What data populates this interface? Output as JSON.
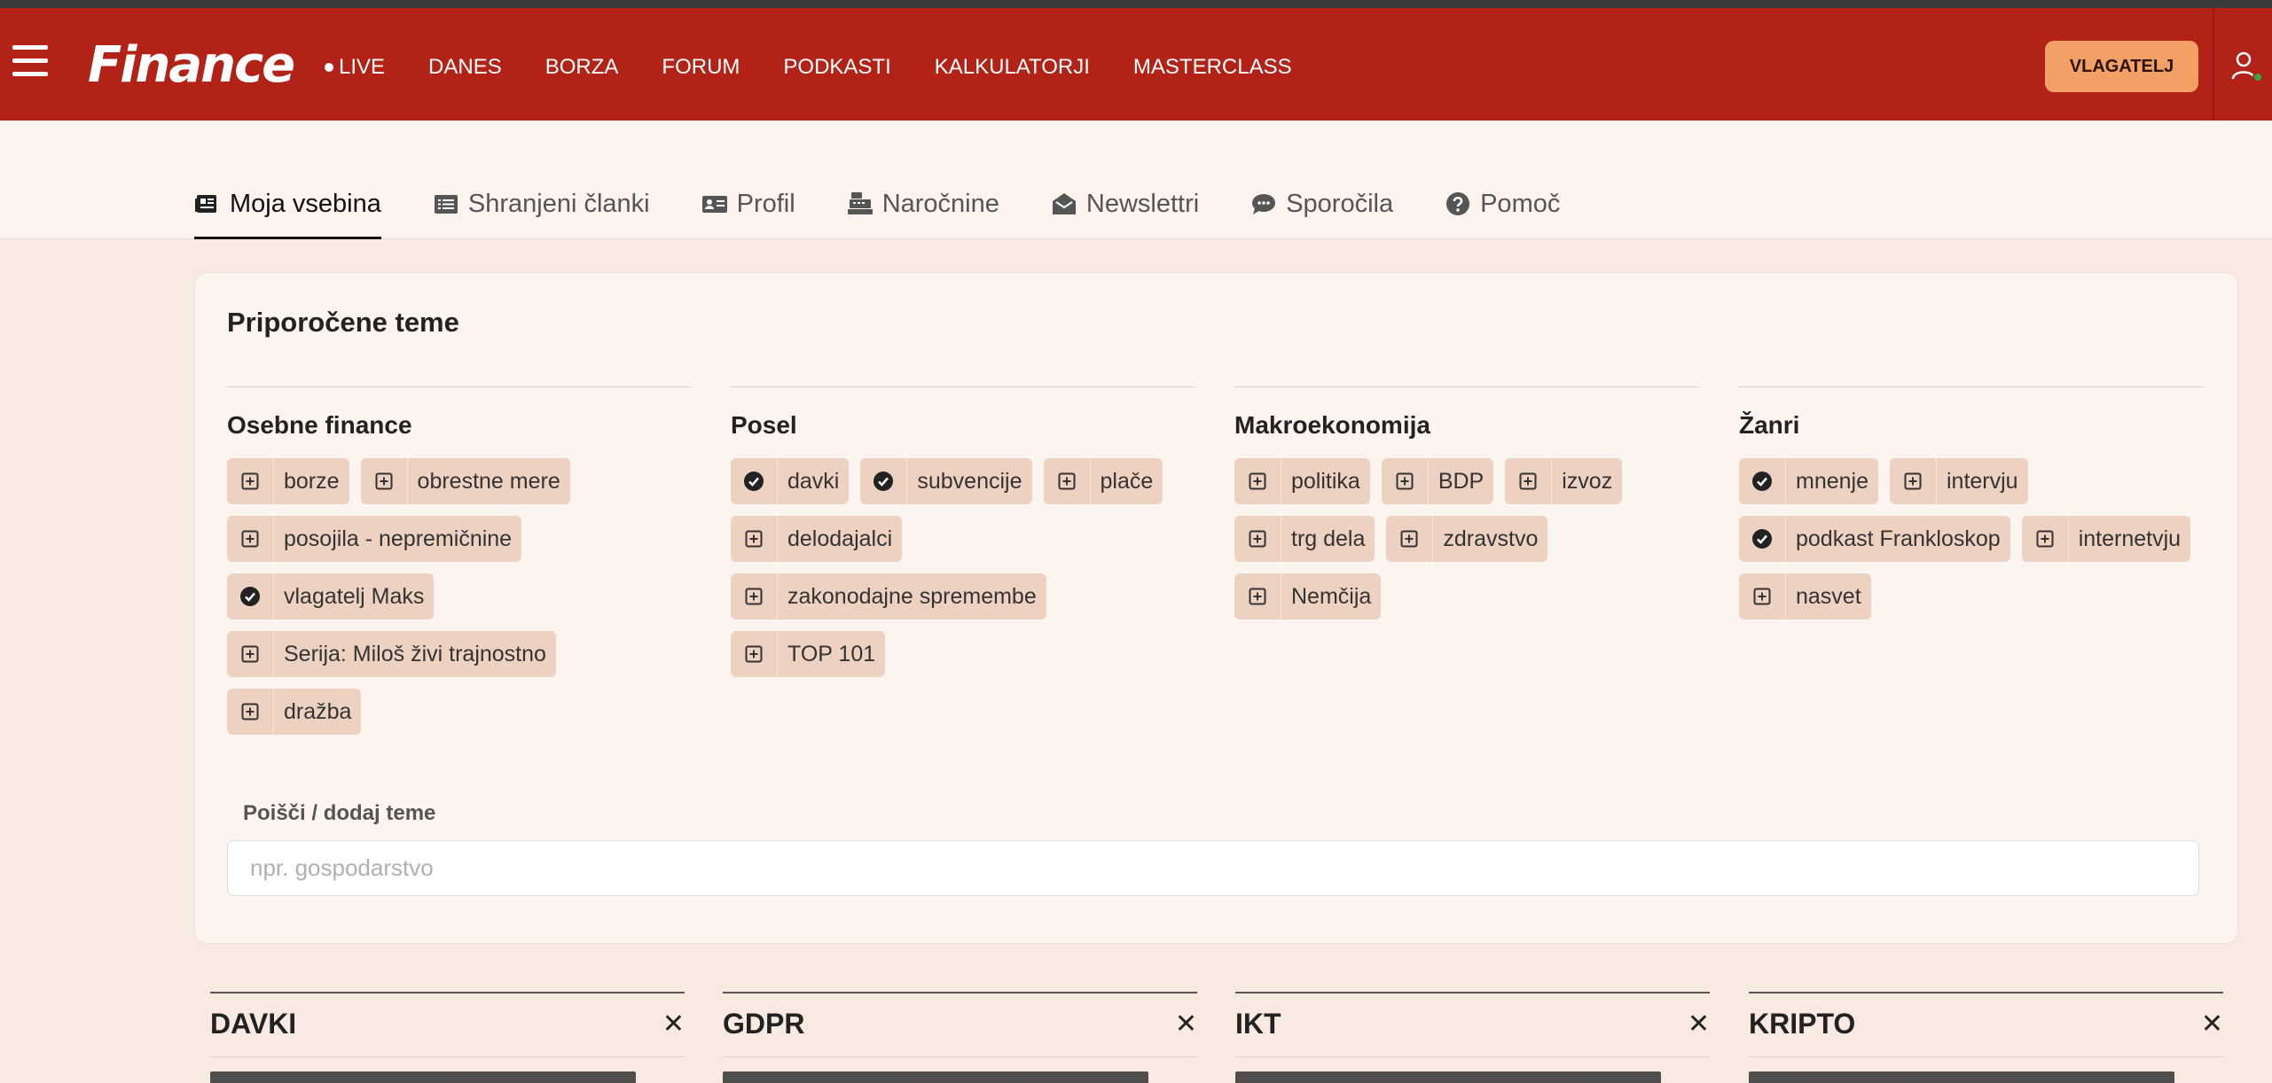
{
  "header": {
    "logo": "Finance",
    "nav": [
      {
        "label": "LIVE",
        "dot": true
      },
      {
        "label": "DANES"
      },
      {
        "label": "BORZA"
      },
      {
        "label": "FORUM"
      },
      {
        "label": "PODKASTI"
      },
      {
        "label": "KALKULATORJI"
      },
      {
        "label": "MASTERCLASS"
      }
    ],
    "cta_label": "VLAGATELJ",
    "colors": {
      "bar": "#b22217",
      "cta": "#f2a065"
    }
  },
  "tabs": [
    {
      "label": "Moja vsebina",
      "icon": "newspaper-icon",
      "active": true
    },
    {
      "label": "Shranjeni članki",
      "icon": "list-icon"
    },
    {
      "label": "Profil",
      "icon": "id-card-icon"
    },
    {
      "label": "Naročnine",
      "icon": "cash-register-icon"
    },
    {
      "label": "Newslettri",
      "icon": "envelope-open-icon"
    },
    {
      "label": "Sporočila",
      "icon": "comments-icon"
    },
    {
      "label": "Pomoč",
      "icon": "question-circle-icon"
    }
  ],
  "recommended": {
    "title": "Priporočene teme",
    "columns": [
      {
        "title": "Osebne finance",
        "chips": [
          {
            "label": "borze",
            "selected": false
          },
          {
            "label": "obrestne mere",
            "selected": false
          },
          {
            "label": "posojila - nepremičnine",
            "selected": false
          },
          {
            "label": "vlagatelj Maks",
            "selected": true
          },
          {
            "label": "Serija: Miloš živi trajnostno",
            "selected": false
          },
          {
            "label": "dražba",
            "selected": false
          }
        ]
      },
      {
        "title": "Posel",
        "chips": [
          {
            "label": "davki",
            "selected": true
          },
          {
            "label": "subvencije",
            "selected": true
          },
          {
            "label": "plače",
            "selected": false
          },
          {
            "label": "delodajalci",
            "selected": false
          },
          {
            "label": "zakonodajne spremembe",
            "selected": false
          },
          {
            "label": "TOP 101",
            "selected": false
          }
        ]
      },
      {
        "title": "Makroekonomija",
        "chips": [
          {
            "label": "politika",
            "selected": false
          },
          {
            "label": "BDP",
            "selected": false
          },
          {
            "label": "izvoz",
            "selected": false
          },
          {
            "label": "trg dela",
            "selected": false
          },
          {
            "label": "zdravstvo",
            "selected": false
          },
          {
            "label": "Nemčija",
            "selected": false
          }
        ]
      },
      {
        "title": "Žanri",
        "chips": [
          {
            "label": "mnenje",
            "selected": true
          },
          {
            "label": "intervju",
            "selected": false
          },
          {
            "label": "podkast Frankloskop",
            "selected": true
          },
          {
            "label": "internetvju",
            "selected": false
          },
          {
            "label": "nasvet",
            "selected": false
          }
        ]
      }
    ],
    "search": {
      "label": "Poišči / dodaj teme",
      "placeholder": "npr. gospodarstvo",
      "value": ""
    }
  },
  "followed_topics": [
    {
      "name": "DAVKI"
    },
    {
      "name": "GDPR"
    },
    {
      "name": "IKT"
    },
    {
      "name": "KRIPTO"
    }
  ]
}
